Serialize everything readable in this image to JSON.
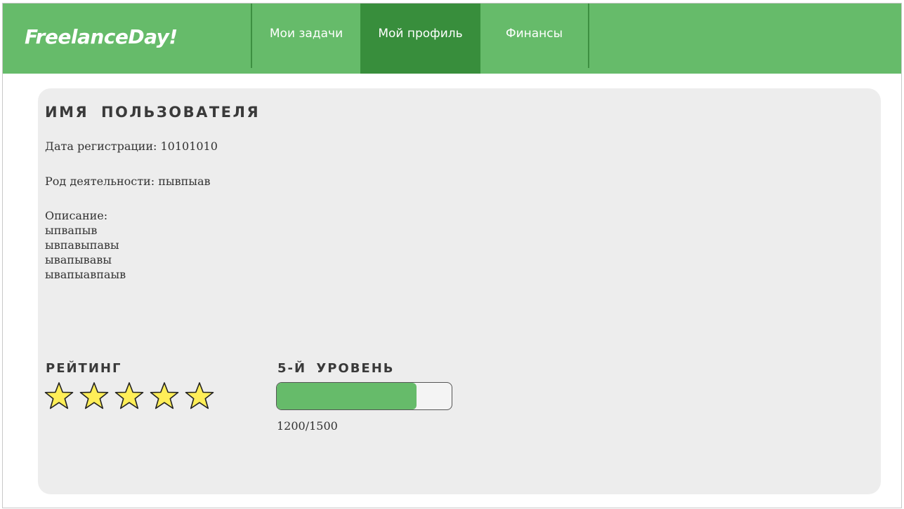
{
  "header": {
    "logo": "FreelanceDay!",
    "nav": [
      {
        "label": "Мои задачи",
        "active": false
      },
      {
        "label": "Мой профиль",
        "active": true
      },
      {
        "label": "Финансы",
        "active": false
      }
    ]
  },
  "profile": {
    "username": "ИМЯ ПОЛЬЗОВАТЕЛЯ",
    "registration": "Дата регистрации: 10101010",
    "occupation": "Род деятельности: пывпыав",
    "description_label": "Описание:",
    "description_lines": [
      "ыпвапыв",
      "ывпавыпавы",
      "ывапывавы",
      "ывапыавпаыв"
    ]
  },
  "rating": {
    "label": "РЕЙТИНГ",
    "stars": 5,
    "max_stars": 5
  },
  "level": {
    "label": "5-Й УРОВЕНЬ",
    "progress_text": "1200/1500",
    "progress_fraction": 0.8
  },
  "colors": {
    "header": "#66bb6a",
    "nav_active": "#388e3c",
    "star_fill": "#ffee58",
    "progress_fill": "#66bb6a"
  }
}
